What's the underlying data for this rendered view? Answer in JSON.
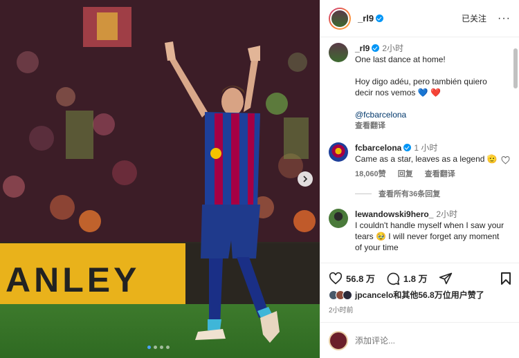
{
  "post": {
    "username": "_rl9",
    "follow_label": "已关注",
    "more_label": "···"
  },
  "photo": {
    "banner_text": "ANLEY",
    "carousel": {
      "slides": 4,
      "active": 1
    }
  },
  "caption": {
    "username": "_rl9",
    "time": "2小时",
    "line1": "One last dance at home!",
    "line2": "Hoy digo adéu, pero también quiero decir nos vemos 💙 ❤️",
    "mention": "@fcbarcelona",
    "translate_label": "查看翻译"
  },
  "comments": [
    {
      "username": "fcbarcelona",
      "time": "1 小时",
      "text": "Came as a star, leaves as a legend 🫡",
      "likes": "18,060赞",
      "reply_label": "回复",
      "translate_label": "查看翻译",
      "replies_label": "查看所有36条回复"
    },
    {
      "username": "lewandowski9hero_",
      "time": "2小时",
      "text": "I couldn't handle myself when I saw your tears 🥹 I will never forget any moment of your time"
    }
  ],
  "actions": {
    "likes_count": "56.8 万",
    "comments_count": "1.8 万"
  },
  "liked_by": {
    "text": "jpcancelo和其他56.8万位用户赞了"
  },
  "posted_ago": "2小时前",
  "add_comment": {
    "placeholder": "添加评论..."
  },
  "colors": {
    "verified": "#0095f6",
    "link": "#00376b",
    "barca_blue": "#1d3f9a",
    "barca_red": "#a50044"
  }
}
